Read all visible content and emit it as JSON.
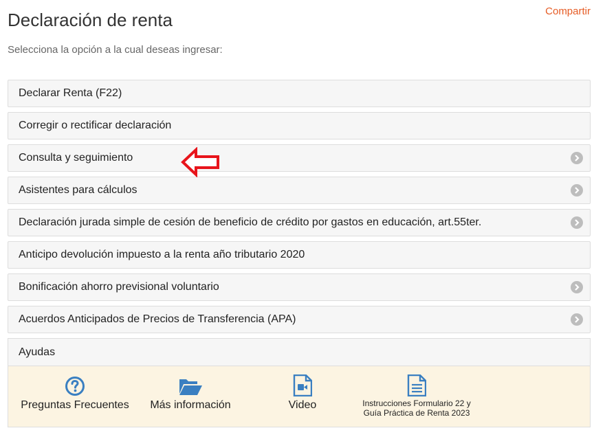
{
  "header": {
    "title": "Declaración de renta",
    "subtitle": "Selecciona la opción a la cual deseas ingresar:",
    "share_label": "Compartir"
  },
  "options": [
    {
      "label": "Declarar Renta (F22)",
      "has_chevron": false
    },
    {
      "label": "Corregir o rectificar declaración",
      "has_chevron": false
    },
    {
      "label": "Consulta y seguimiento",
      "has_chevron": true
    },
    {
      "label": "Asistentes para cálculos",
      "has_chevron": true
    },
    {
      "label": "Declaración jurada simple de cesión de beneficio de crédito por gastos en educación, art.55ter.",
      "has_chevron": true
    },
    {
      "label": "Anticipo devolución impuesto a la renta año tributario 2020",
      "has_chevron": false
    },
    {
      "label": "Bonificación ahorro previsional voluntario",
      "has_chevron": true
    },
    {
      "label": "Acuerdos Anticipados de Precios de Transferencia (APA)",
      "has_chevron": true
    }
  ],
  "help": {
    "title": "Ayudas",
    "items": [
      {
        "label": "Preguntas Frecuentes",
        "icon": "question-circle-icon"
      },
      {
        "label": "Más información",
        "icon": "folder-open-icon"
      },
      {
        "label": "Video",
        "icon": "video-file-icon"
      },
      {
        "label_line1": "Instrucciones Formulario 22 y",
        "label_line2": "Guía Práctica de Renta 2023",
        "icon": "document-icon"
      }
    ]
  },
  "colors": {
    "accent": "#e65c25",
    "icon_blue": "#3a7fc1",
    "help_background": "#fcf4e2",
    "annotation_arrow": "#e8141b"
  }
}
